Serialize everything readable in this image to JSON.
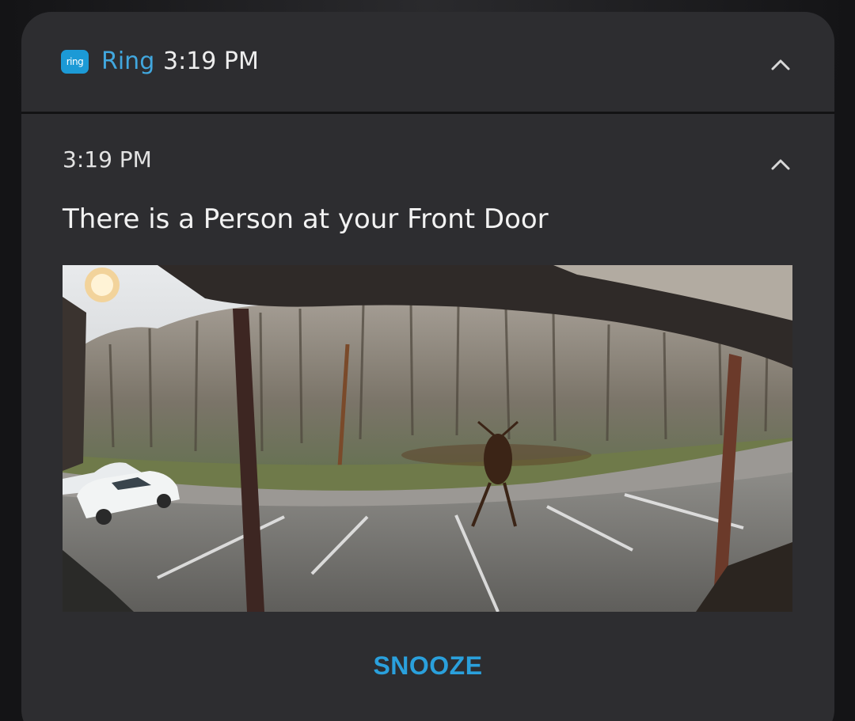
{
  "app": {
    "badge_text": "ring",
    "name": "Ring",
    "time": "3:19 PM",
    "accent_color": "#41a7de",
    "collapse_icon": "chevron-up-icon"
  },
  "message": {
    "time": "3:19 PM",
    "text": "There is a Person at your Front Door",
    "expand_icon": "chevron-up-icon"
  },
  "snapshot": {
    "description_icon": "camera-snapshot-image"
  },
  "actions": {
    "snooze_label": "SNOOZE",
    "snooze_color": "#2aa0dc"
  }
}
